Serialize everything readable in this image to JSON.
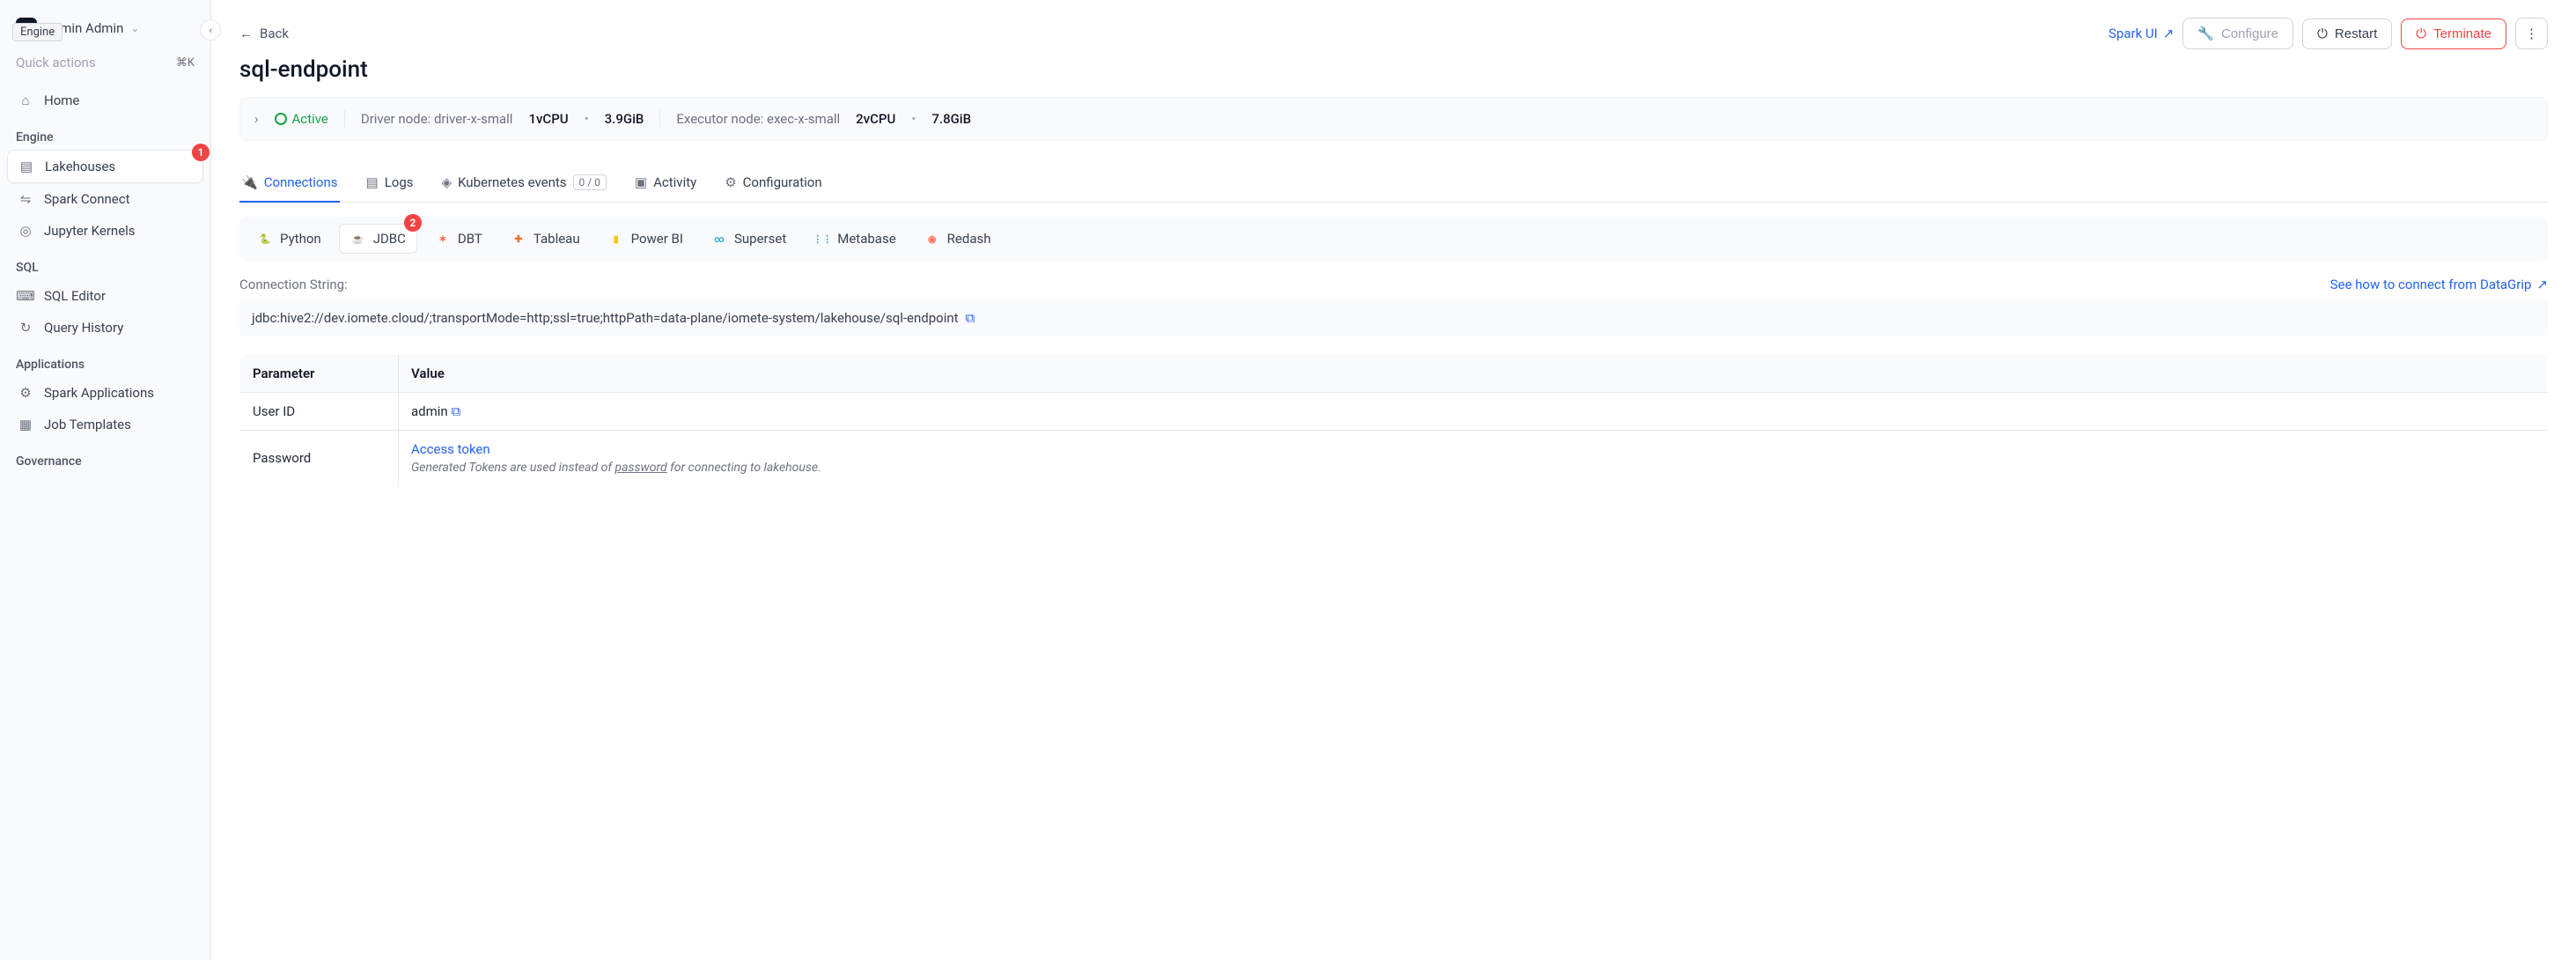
{
  "user": {
    "name": "Admin Admin"
  },
  "tooltip": "Engine",
  "quick_actions": {
    "label": "Quick actions",
    "shortcut": "⌘K"
  },
  "sidebar": {
    "home": "Home",
    "sections": {
      "engine": {
        "label": "Engine",
        "items": [
          "Lakehouses",
          "Spark Connect",
          "Jupyter Kernels"
        ]
      },
      "sql": {
        "label": "SQL",
        "items": [
          "SQL Editor",
          "Query History"
        ]
      },
      "applications": {
        "label": "Applications",
        "items": [
          "Spark Applications",
          "Job Templates"
        ]
      },
      "governance": {
        "label": "Governance"
      }
    }
  },
  "annotations": {
    "one": "1",
    "two": "2"
  },
  "header": {
    "back": "Back",
    "spark_ui": "Spark UI",
    "configure": "Configure",
    "restart": "Restart",
    "terminate": "Terminate"
  },
  "title": "sql-endpoint",
  "status": {
    "state": "Active",
    "driver_label": "Driver node: driver-x-small",
    "driver_cpu": "1vCPU",
    "driver_mem": "3.9GiB",
    "executor_label": "Executor node: exec-x-small",
    "executor_cpu": "2vCPU",
    "executor_mem": "7.8GiB"
  },
  "tabs": {
    "connections": "Connections",
    "logs": "Logs",
    "k8s": "Kubernetes events",
    "k8s_count": "0 / 0",
    "activity": "Activity",
    "configuration": "Configuration"
  },
  "connectors": [
    "Python",
    "JDBC",
    "DBT",
    "Tableau",
    "Power BI",
    "Superset",
    "Metabase",
    "Redash"
  ],
  "connection": {
    "label": "Connection String:",
    "help_link": "See how to connect from DataGrip",
    "value": "jdbc:hive2://dev.iomete.cloud/;transportMode=http;ssl=true;httpPath=data-plane/iomete-system/lakehouse/sql-endpoint"
  },
  "params": {
    "header_param": "Parameter",
    "header_value": "Value",
    "user_id_label": "User ID",
    "user_id_value": "admin",
    "password_label": "Password",
    "password_link": "Access token",
    "password_hint_prefix": "Generated Tokens are used instead of ",
    "password_hint_underline": "password",
    "password_hint_suffix": " for connecting to lakehouse."
  }
}
